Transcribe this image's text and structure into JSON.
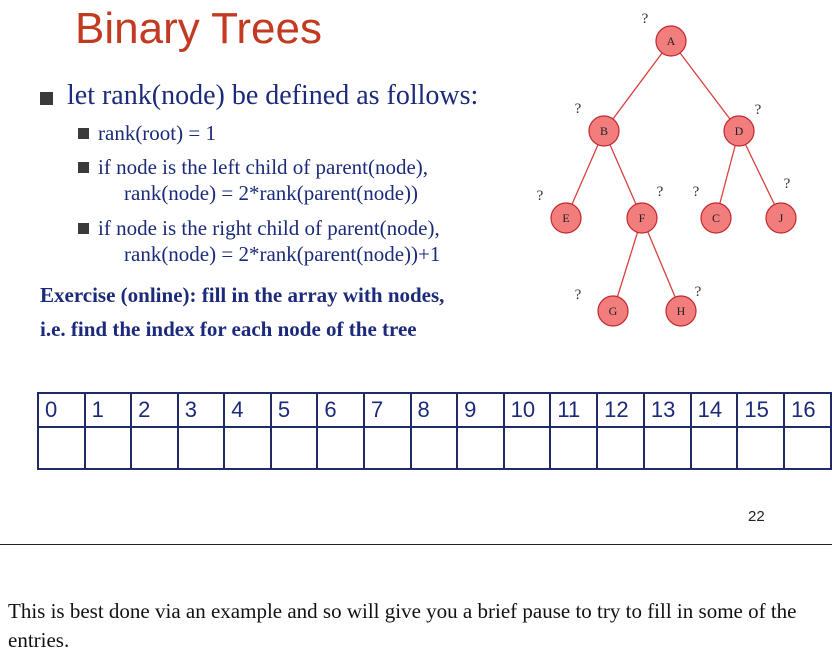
{
  "slide": {
    "title": "Binary Trees",
    "bullet_main": "let rank(node) be defined as follows:",
    "sub1": "rank(root) = 1",
    "sub2_line1": "if node is the left child of parent(node),",
    "sub2_line2": "rank(node) = 2*rank(parent(node))",
    "sub3_line1": "if node is the right child of parent(node),",
    "sub3_line2": "rank(node) = 2*rank(parent(node))+1",
    "exercise_line1": "Exercise (online): fill in the array with nodes,",
    "exercise_line2": "i.e. find the index for each node of the tree",
    "page_number": "22"
  },
  "tree": {
    "node_fill": "#f27d7d",
    "node_stroke": "#c0282d",
    "edge_color": "#d94040",
    "unknown_mark": "?",
    "nodes": [
      "A",
      "B",
      "D",
      "E",
      "F",
      "C",
      "J",
      "G",
      "H"
    ]
  },
  "array": {
    "indices": [
      "0",
      "1",
      "2",
      "3",
      "4",
      "5",
      "6",
      "7",
      "8",
      "9",
      "10",
      "11",
      "12",
      "13",
      "14",
      "15",
      "16"
    ]
  },
  "notes": {
    "text": "This is best done via an example and so will give you a brief pause to try to fill in some of the entries."
  }
}
